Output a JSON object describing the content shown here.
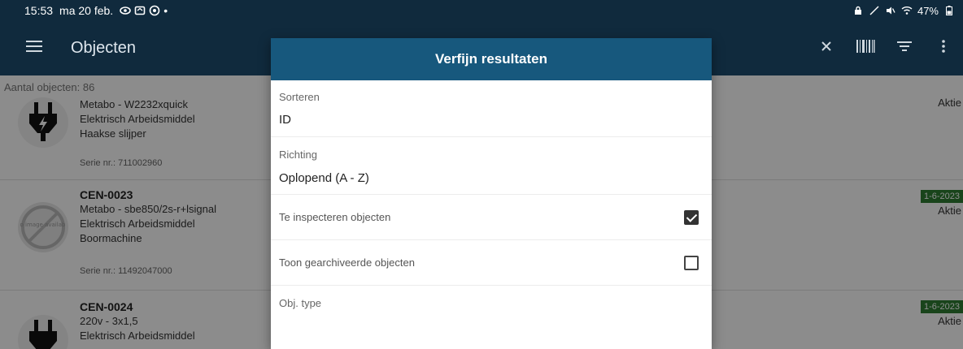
{
  "statusbar": {
    "time": "15:53",
    "date": "ma 20 feb.",
    "dot": "•",
    "battery": "47%"
  },
  "appbar": {
    "title": "Objecten"
  },
  "list": {
    "count_label": "Aantal objecten: 86",
    "items": [
      {
        "code": "",
        "line1": "Metabo - W2232xquick",
        "line2": "Elektrisch Arbeidsmiddel",
        "line3": "Haakse slijper",
        "serial": "Serie nr.: 711002960",
        "date": "",
        "status": "Aktie"
      },
      {
        "code": "CEN-0023",
        "line1": "Metabo - sbe850/2s-r+lsignal",
        "line2": "Elektrisch Arbeidsmiddel",
        "line3": "Boormachine",
        "serial": "Serie nr.: 11492047000",
        "date": "1-6-2023",
        "status": "Aktie",
        "placeholder_text": "No image available"
      },
      {
        "code": "CEN-0024",
        "line1": "220v - 3x1,5",
        "line2": "Elektrisch Arbeidsmiddel",
        "line3": "",
        "serial": "",
        "date": "1-6-2023",
        "status": "Aktie"
      }
    ]
  },
  "dialog": {
    "title": "Verfijn resultaten",
    "sort_label": "Sorteren",
    "sort_value": "ID",
    "direction_label": "Richting",
    "direction_value": "Oplopend (A - Z)",
    "inspect_label": "Te inspecteren objecten",
    "inspect_checked": true,
    "archived_label": "Toon gearchiveerde objecten",
    "archived_checked": false,
    "objtype_label": "Obj. type",
    "objtype_value": ""
  },
  "colors": {
    "appbar": "#102a3d",
    "dialog_header": "#17587d",
    "date_badge": "#2e7d32"
  }
}
